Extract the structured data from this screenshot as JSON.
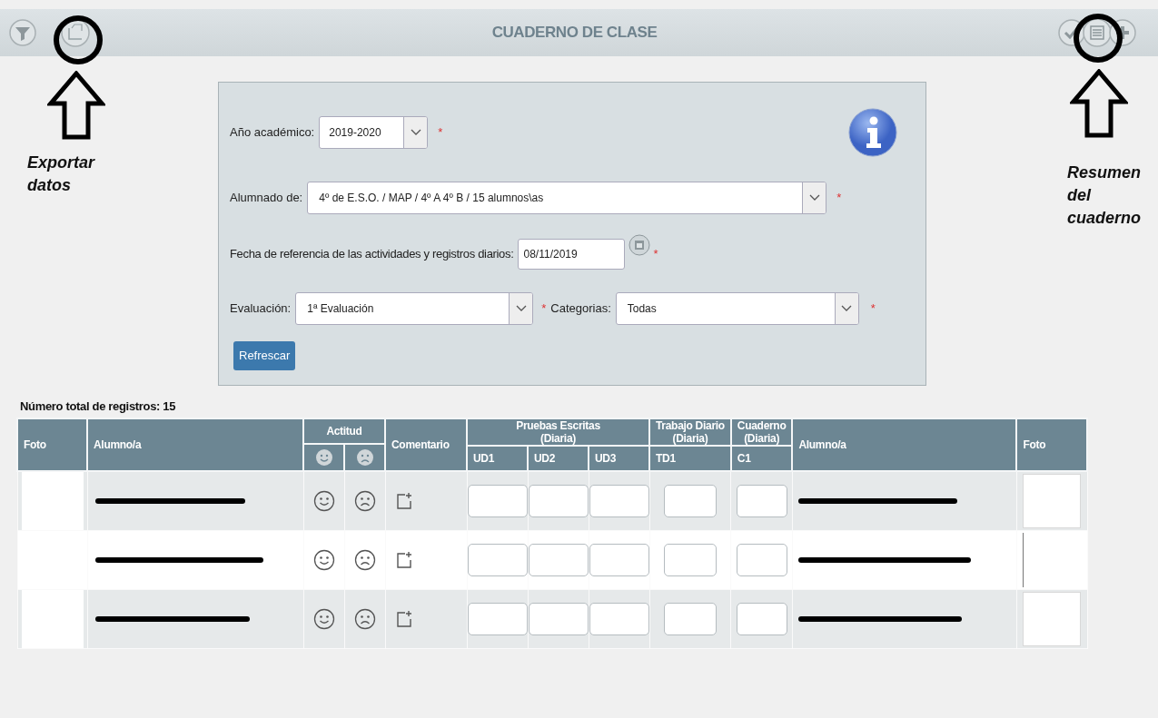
{
  "top_bar": {
    "title": "CUADERNO DE CLASE"
  },
  "annotations": {
    "left_caption": "Exportar datos",
    "right_caption": "Resumen del cuaderno"
  },
  "form": {
    "year": {
      "label": "Año académico:",
      "value": "2019-2020",
      "required_mark": "*"
    },
    "students": {
      "label": "Alumnado de:",
      "value": "4º de E.S.O. / MAP / 4º A 4º B / 15 alumnos\\as",
      "required_mark": "*"
    },
    "date": {
      "label": "Fecha de referencia de las actividades y registros diarios:",
      "value": "08/11/2019",
      "required_mark": "*"
    },
    "evaluation": {
      "label": "Evaluación:",
      "value": "1ª Evaluación",
      "required_mark": "*"
    },
    "categories": {
      "label": "Categorias:",
      "value": "Todas",
      "required_mark": "*"
    },
    "refresh_button": "Refrescar"
  },
  "total": "Número total de registros: 15",
  "header": {
    "photo": "Foto",
    "student": "Alumno/a",
    "attitude": "Actitud",
    "comment": "Comentario",
    "groups": [
      {
        "title": "Pruebas Escritas\n(Diaria)",
        "columns": [
          "UD1",
          "UD2",
          "UD3"
        ]
      },
      {
        "title": "Trabajo Diario\n(Diaria)",
        "columns": [
          "TD1"
        ]
      },
      {
        "title": "Cuaderno\n(Diaria)",
        "columns": [
          "C1"
        ]
      }
    ],
    "student_right": "Alumno/a",
    "photo_right": "Foto"
  },
  "rows": [
    {
      "shaded": true,
      "photo": true
    },
    {
      "shaded": false,
      "photo": false
    },
    {
      "shaded": true,
      "photo": true
    }
  ]
}
